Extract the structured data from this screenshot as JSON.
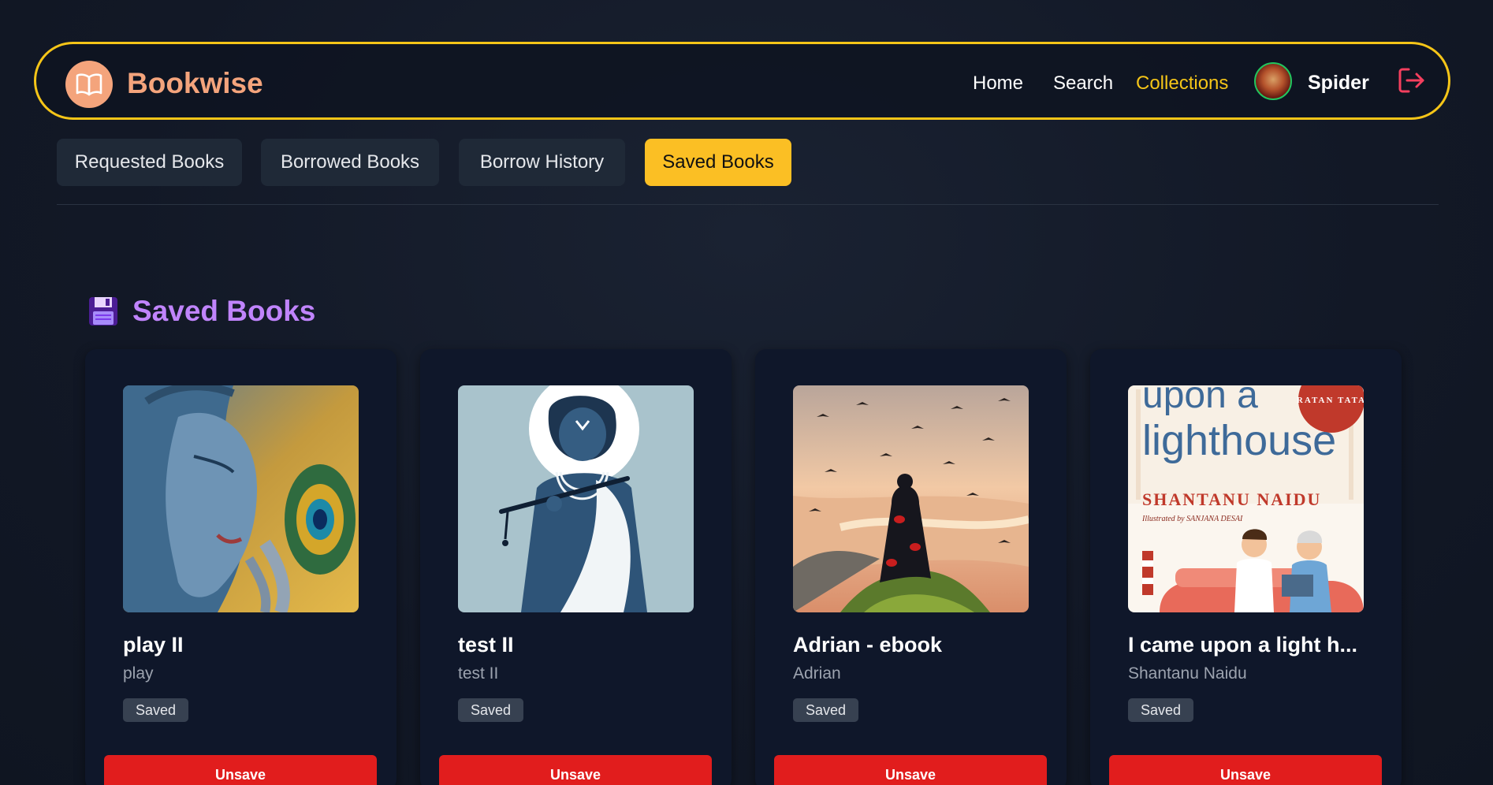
{
  "brand": {
    "name": "Bookwise",
    "logo_icon": "open-book-icon"
  },
  "nav": {
    "links": [
      "Home",
      "Search",
      "Collections"
    ],
    "active": "Collections",
    "user": {
      "name": "Spider",
      "avatar": "user-avatar"
    },
    "logout_icon": "logout-icon"
  },
  "tabs": {
    "items": [
      "Requested Books",
      "Borrowed Books",
      "Borrow History",
      "Saved Books"
    ],
    "active": "Saved Books"
  },
  "section": {
    "icon": "floppy-disk-icon",
    "title": "Saved Books"
  },
  "books": [
    {
      "title": "play II",
      "author": "play",
      "badge": "Saved",
      "action": "Unsave",
      "cover": "blue-face-peacock-feather-painting"
    },
    {
      "title": "test II",
      "author": "test II",
      "badge": "Saved",
      "action": "Unsave",
      "cover": "blue-figure-playing-flute"
    },
    {
      "title": "Adrian - ebook",
      "author": "Adrian",
      "badge": "Saved",
      "action": "Unsave",
      "cover": "cloaked-figure-on-cliff-at-sunset"
    },
    {
      "title": "I came upon a light h...",
      "author": "Shantanu Naidu",
      "badge": "Saved",
      "action": "Unsave",
      "cover": "lighthouse-book-cover"
    }
  ],
  "cover4_text": {
    "line1": "upon a",
    "line2": "lighthouse",
    "author": "SHANTANU NAIDU",
    "illustrator": "Illustrated by SANJANA DESAI",
    "seal": "RATAN TATA"
  },
  "colors": {
    "accent": "#f5c518",
    "brand": "#f4a47c",
    "heading": "#c084fc",
    "danger": "#e11d1d",
    "active_tab": "#fbbf24"
  }
}
